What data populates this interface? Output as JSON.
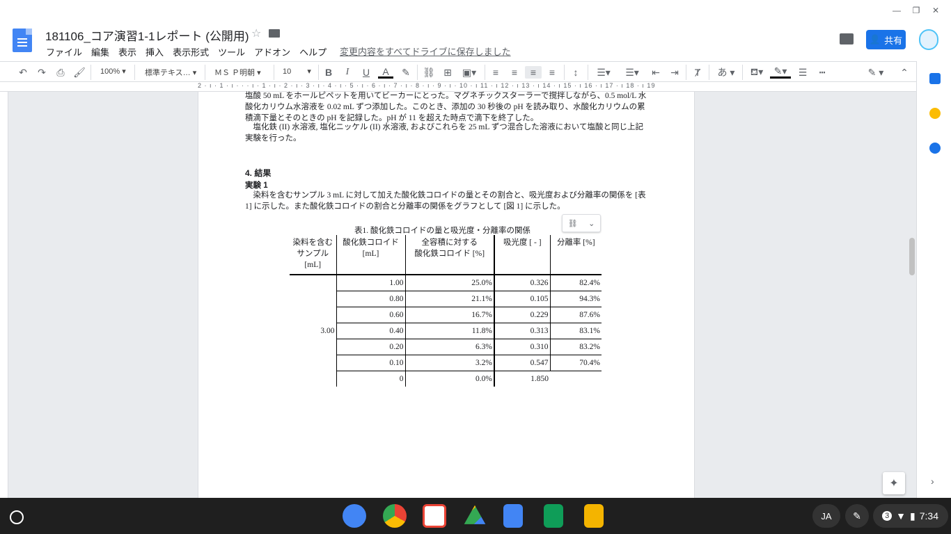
{
  "document": {
    "title": "181106_コア演習1-1レポート (公開用)",
    "save_status": "変更内容をすべてドライブに保存しました",
    "share_label": "共有"
  },
  "menu": [
    "ファイル",
    "編集",
    "表示",
    "挿入",
    "表示形式",
    "ツール",
    "アドオン",
    "ヘルプ"
  ],
  "toolbar": {
    "zoom": "100%",
    "style": "標準テキス…",
    "font": "ＭＳ Ｐ明朝",
    "size": "10"
  },
  "ruler": {
    "marks": "2 · ı · 1 · ı · · · ı · 1 · ı · 2 · ı · 3 · ı · 4 · ı · 5 · ı · 6 · ı · 7 · ı · 8 · ı · 9 · ı · 10 · ı 11 · ı 12 · ı 13 · ı 14 · ı 15 · ı 16 · ı 17 · ı 18 · ı 19"
  },
  "body": {
    "p1": "塩酸 50 mL をホールピペットを用いてビーカーにとった。マグネチックスターラーで撹拌しながら、0.5 mol/L 水酸化カリウム水溶液を 0.02 mL ずつ添加した。このとき、添加の 30 秒後の pH を読み取り、水酸化カリウムの累積滴下量とそのときの pH を記録した。pH が 11 を超えた時点で滴下を終了した。",
    "p2": "　塩化鉄 (II) 水溶液, 塩化ニッケル (II) 水溶液, およびこれらを 25 mL ずつ混合した溶液において塩酸と同じ上記実験を行った。",
    "h_results": "4. 結果",
    "h_exp1": "実験 1",
    "p3": "　染料を含むサンプル 3 mL に対して加えた酸化鉄コロイドの量とその割合と、吸光度および分離率の関係を [表 1] に示した。また酸化鉄コロイドの割合と分離率の関係をグラフとして [図 1] に示した。"
  },
  "table": {
    "caption": "表1. 酸化鉄コロイドの量と吸光度・分離率の関係",
    "headers": [
      "染料を含む\nサンプル\n[mL]",
      "酸化鉄コロイド\n[mL]",
      "全容積に対する\n酸化鉄コロイド [%]",
      "吸光度 [ - ]",
      "分離率 [%]"
    ],
    "sample": "3.00",
    "rows": [
      [
        "1.00",
        "25.0%",
        "0.326",
        "82.4%"
      ],
      [
        "0.80",
        "21.1%",
        "0.105",
        "94.3%"
      ],
      [
        "0.60",
        "16.7%",
        "0.229",
        "87.6%"
      ],
      [
        "0.40",
        "11.8%",
        "0.313",
        "83.1%"
      ],
      [
        "0.20",
        "6.3%",
        "0.310",
        "83.2%"
      ],
      [
        "0.10",
        "3.2%",
        "0.547",
        "70.4%"
      ],
      [
        "0",
        "0.0%",
        "1.850",
        ""
      ]
    ]
  },
  "taskbar": {
    "ime": "JA",
    "notification_count": "3",
    "time": "7:34"
  },
  "colors": {
    "accent": "#1a73e8",
    "docs_blue": "#4285f4",
    "taskbar": "#1f1f1f"
  }
}
